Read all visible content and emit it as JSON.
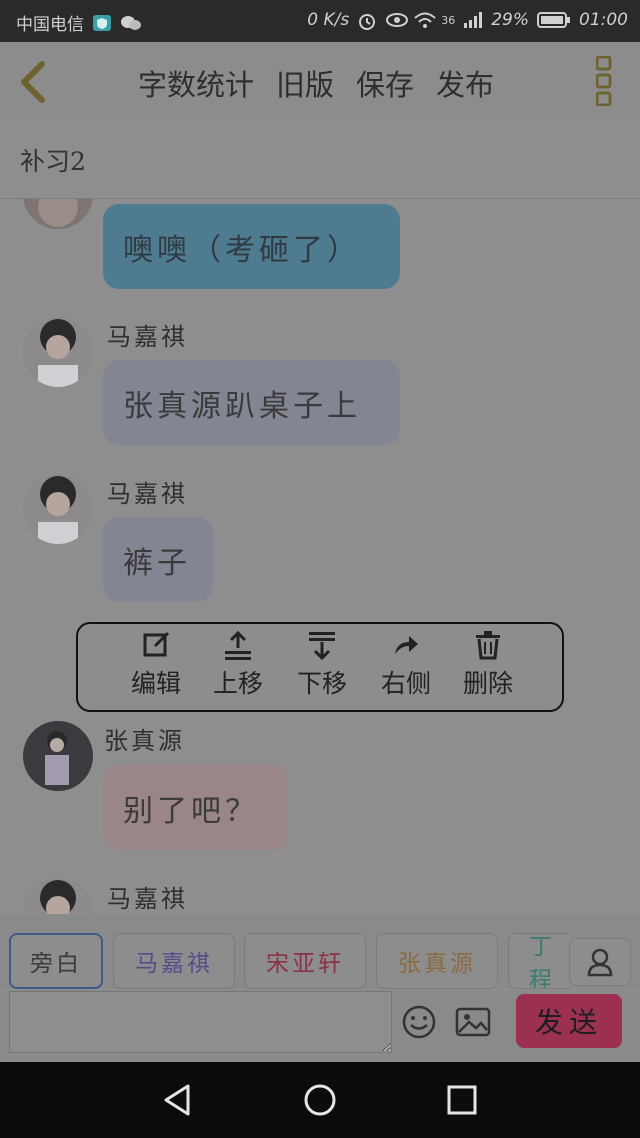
{
  "status_bar": {
    "carrier": "中国电信",
    "speed": "0 K/s",
    "network": "36",
    "battery": "29%",
    "time": "01:00"
  },
  "header": {
    "actions": [
      "字数统计",
      "旧版",
      "保存",
      "发布"
    ]
  },
  "title": "补习2",
  "messages": [
    {
      "name": "",
      "text": "噢噢（考砸了）"
    },
    {
      "name": "马嘉祺",
      "text": "张真源趴桌子上"
    },
    {
      "name": "马嘉祺",
      "text": "裤子"
    },
    {
      "name": "张真源",
      "text": "别了吧？"
    },
    {
      "name": "马嘉祺",
      "text": ""
    }
  ],
  "context_menu": {
    "edit": "编辑",
    "move_up": "上移",
    "move_down": "下移",
    "right_side": "右侧",
    "delete": "删除"
  },
  "characters": [
    "旁白",
    "马嘉祺",
    "宋亚轩",
    "张真源",
    "丁程"
  ],
  "input": {
    "placeholder": "",
    "send": "发送"
  },
  "colors": {
    "accent_blue": "#5b9bc0",
    "bubble_gray": "#9aa0aa",
    "bubble_pink": "#a89090",
    "send_pink": "#9b3050"
  }
}
